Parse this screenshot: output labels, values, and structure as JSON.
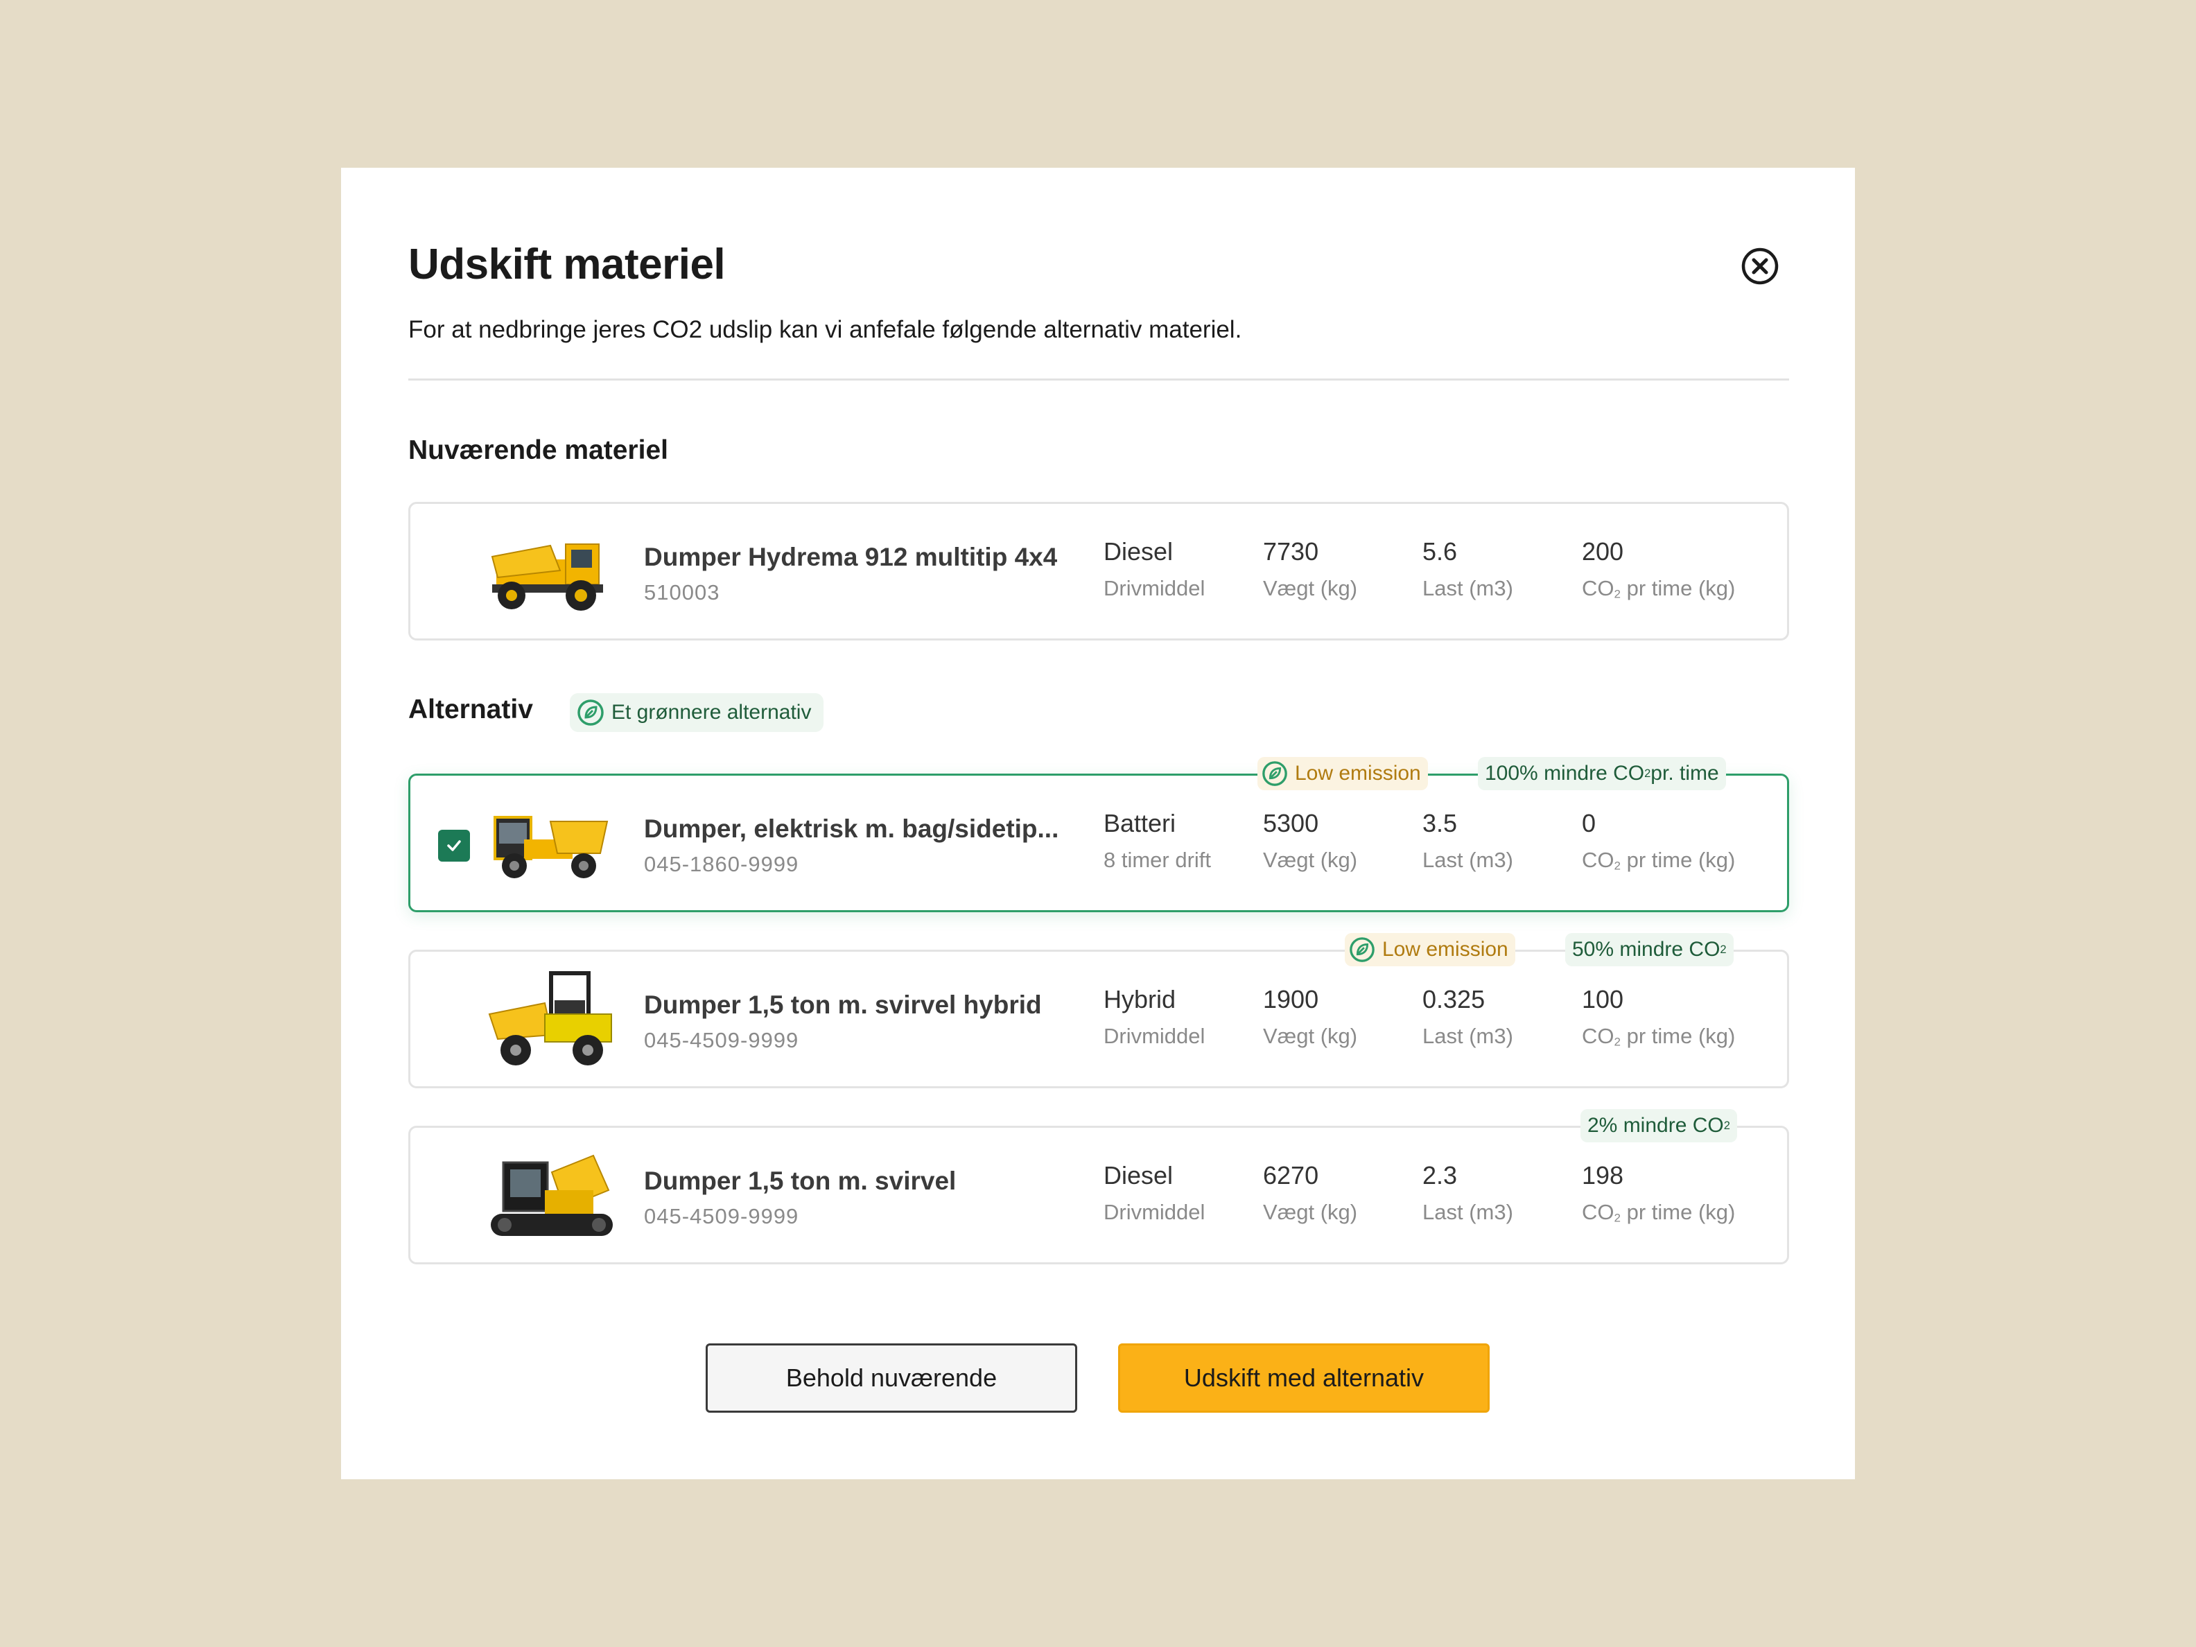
{
  "modal": {
    "title": "Udskift materiel",
    "subtitle": "For at nedbringe jeres CO2 udslip kan vi anfefale følgende alternativ materiel."
  },
  "current": {
    "heading": "Nuværende materiel",
    "item": {
      "name": "Dumper Hydrema 912 multitip 4x4",
      "code": "510003",
      "fuel": "Diesel",
      "fuel_label": "Drivmiddel",
      "weight": "7730",
      "weight_label": "Vægt (kg)",
      "load": "5.6",
      "load_label": "Last (m3)",
      "co2": "200",
      "co2_label_pre": "CO",
      "co2_label_sub": "2",
      "co2_label_post": " pr time (kg)"
    }
  },
  "alternatives": {
    "heading": "Alternativ",
    "badge": "Et grønnere alternativ",
    "items": [
      {
        "name": "Dumper, elektrisk m. bag/sidetip...",
        "code": "045-1860-9999",
        "fuel": "Batteri",
        "fuel_label": "8 timer drift",
        "weight": "5300",
        "load": "3.5",
        "co2": "0",
        "tag_low": "Low emission",
        "tag_co2_pre": "100% mindre CO",
        "tag_co2_sub": "2",
        "tag_co2_post": " pr. time",
        "selected": true
      },
      {
        "name": "Dumper 1,5 ton m. svirvel hybrid",
        "code": "045-4509-9999",
        "fuel": "Hybrid",
        "fuel_label": "Drivmiddel",
        "weight": "1900",
        "load": "0.325",
        "co2": "100",
        "tag_low": "Low emission",
        "tag_co2_pre": "50% mindre CO",
        "tag_co2_sub": "2",
        "tag_co2_post": ""
      },
      {
        "name": "Dumper 1,5 ton m. svirvel",
        "code": "045-4509-9999",
        "fuel": "Diesel",
        "fuel_label": "Drivmiddel",
        "weight": "6270",
        "load": "2.3",
        "co2": "198",
        "tag_co2_pre": "2% mindre CO",
        "tag_co2_sub": "2",
        "tag_co2_post": ""
      }
    ],
    "labels": {
      "weight": "Vægt (kg)",
      "load": "Last (m3)",
      "co2_pre": "CO",
      "co2_sub": "2",
      "co2_post": " pr time (kg)"
    }
  },
  "actions": {
    "keep": "Behold nuværende",
    "replace": "Udskift med alternativ"
  },
  "colors": {
    "background": "#e5dcc7",
    "accent_green": "#2e9e6a",
    "checkbox_green": "#1c7a56",
    "primary_button": "#fbb117",
    "low_emission_text": "#b07b10"
  },
  "icons": [
    "close-circle-icon",
    "leaf-icon",
    "check-icon"
  ]
}
